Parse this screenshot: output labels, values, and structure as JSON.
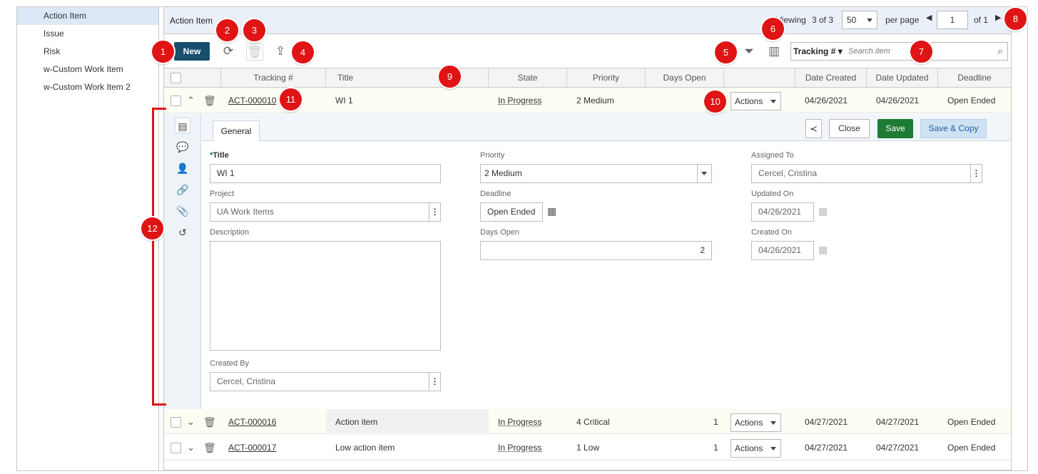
{
  "sidebar": {
    "items": [
      {
        "label": "Action Item"
      },
      {
        "label": "Issue"
      },
      {
        "label": "Risk"
      },
      {
        "label": "w-Custom Work Item"
      },
      {
        "label": "w-Custom Work Item 2"
      }
    ]
  },
  "header": {
    "title": "Action Item",
    "viewing_prefix": "Viewing",
    "viewing_count": "3 of 3",
    "per_page_value": "50",
    "per_page_label": "per page",
    "page_value": "1",
    "page_total": "of 1"
  },
  "toolbar": {
    "new_label": "New",
    "search_field": "Tracking #",
    "search_placeholder": "Search item"
  },
  "grid": {
    "columns": [
      "Tracking #",
      "Title",
      "State",
      "Priority",
      "Days Open",
      "",
      "Date Created",
      "Date Updated",
      "Deadline"
    ],
    "rows": [
      {
        "tracking": "ACT-000010",
        "title": "WI 1",
        "state": "In Progress",
        "priority": "2 Medium",
        "days_open": "",
        "actions": "Actions",
        "date_created": "04/26/2021",
        "date_updated": "04/26/2021",
        "deadline": "Open Ended"
      },
      {
        "tracking": "ACT-000016",
        "title": "Action item",
        "state": "In Progress",
        "priority": "4 Critical",
        "days_open": "1",
        "actions": "Actions",
        "date_created": "04/27/2021",
        "date_updated": "04/27/2021",
        "deadline": "Open Ended"
      },
      {
        "tracking": "ACT-000017",
        "title": "Low action item",
        "state": "In Progress",
        "priority": "1 Low",
        "days_open": "1",
        "actions": "Actions",
        "date_created": "04/27/2021",
        "date_updated": "04/27/2021",
        "deadline": "Open Ended"
      }
    ]
  },
  "detail": {
    "tab_general": "General",
    "close_label": "Close",
    "save_label": "Save",
    "save_copy_label": "Save & Copy",
    "title_label": "Title",
    "title_value": "WI 1",
    "project_label": "Project",
    "project_value": "UA Work Items",
    "description_label": "Description",
    "created_by_label": "Created By",
    "created_by_value": "Cercel, Cristina",
    "priority_label": "Priority",
    "priority_value": "2 Medium",
    "deadline_label": "Deadline",
    "deadline_value": "Open Ended",
    "days_open_label": "Days Open",
    "days_open_value": "2",
    "assigned_label": "Assigned To",
    "assigned_value": "Cercel, Cristina",
    "updated_label": "Updated On",
    "updated_value": "04/26/2021",
    "created_label": "Created On",
    "created_value": "04/26/2021"
  },
  "callouts": [
    "1",
    "2",
    "3",
    "4",
    "5",
    "6",
    "7",
    "8",
    "9",
    "10",
    "11",
    "12"
  ],
  "colors": {
    "accent": "#174f6d",
    "save": "#1e7b34",
    "callout": "#e01414",
    "link": "#1f5fa0"
  },
  "icons": [
    "refresh-icon",
    "trash-icon",
    "export-icon",
    "filter-icon",
    "columns-icon",
    "search-icon",
    "document-icon",
    "comment-icon",
    "user-icon",
    "link-icon",
    "paperclip-icon",
    "history-icon",
    "share-icon",
    "calendar-icon"
  ]
}
